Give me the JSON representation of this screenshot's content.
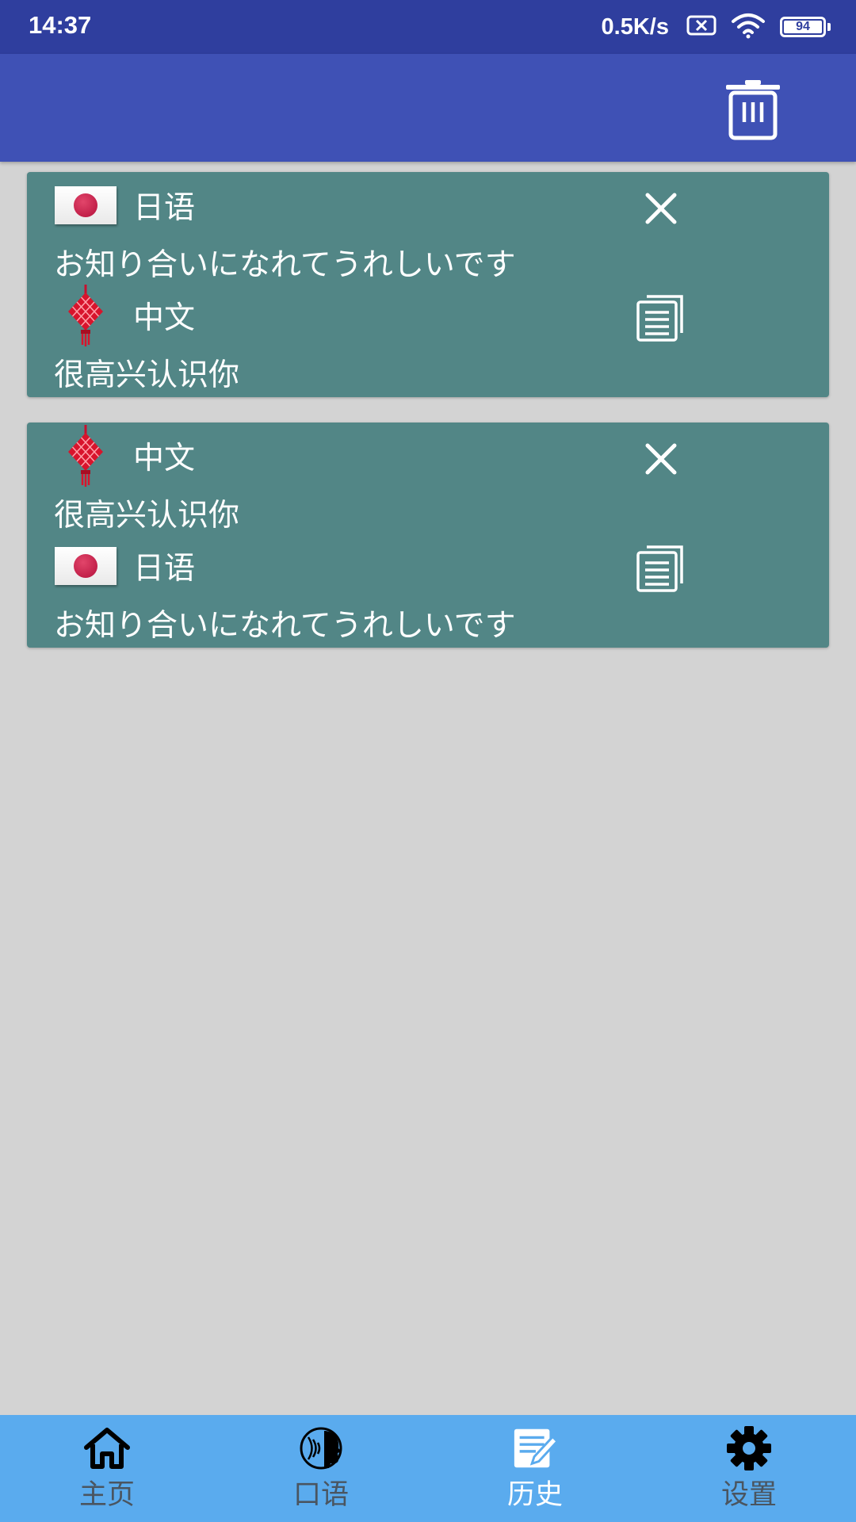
{
  "status_bar": {
    "time": "14:37",
    "net_speed": "0.5K/s",
    "battery_level": "94",
    "icons": [
      "sim-off-icon",
      "wifi-icon",
      "battery-icon"
    ]
  },
  "app_bar": {
    "actions": [
      "trash-icon"
    ]
  },
  "history": [
    {
      "source_lang": "日语",
      "source_flag": "japan-flag-icon",
      "source_text": "お知り合いになれてうれしいです",
      "target_lang": "中文",
      "target_flag": "chinese-knot-icon",
      "target_text": "很高兴认识你"
    },
    {
      "source_lang": "中文",
      "source_flag": "chinese-knot-icon",
      "source_text": "很高兴认识你",
      "target_lang": "日语",
      "target_flag": "japan-flag-icon",
      "target_text": "お知り合いになれてうれしいです"
    }
  ],
  "bottom_nav": {
    "active": "历史",
    "items": [
      {
        "label": "主页",
        "icon": "home-icon"
      },
      {
        "label": "口语",
        "icon": "speaking-icon"
      },
      {
        "label": "历史",
        "icon": "history-icon"
      },
      {
        "label": "设置",
        "icon": "gear-icon"
      }
    ]
  },
  "colors": {
    "status_bar": "#2f3e9e",
    "app_bar": "#3f51b5",
    "background": "#d3d3d3",
    "card": "#528686",
    "bottom_nav": "#5aabee"
  }
}
